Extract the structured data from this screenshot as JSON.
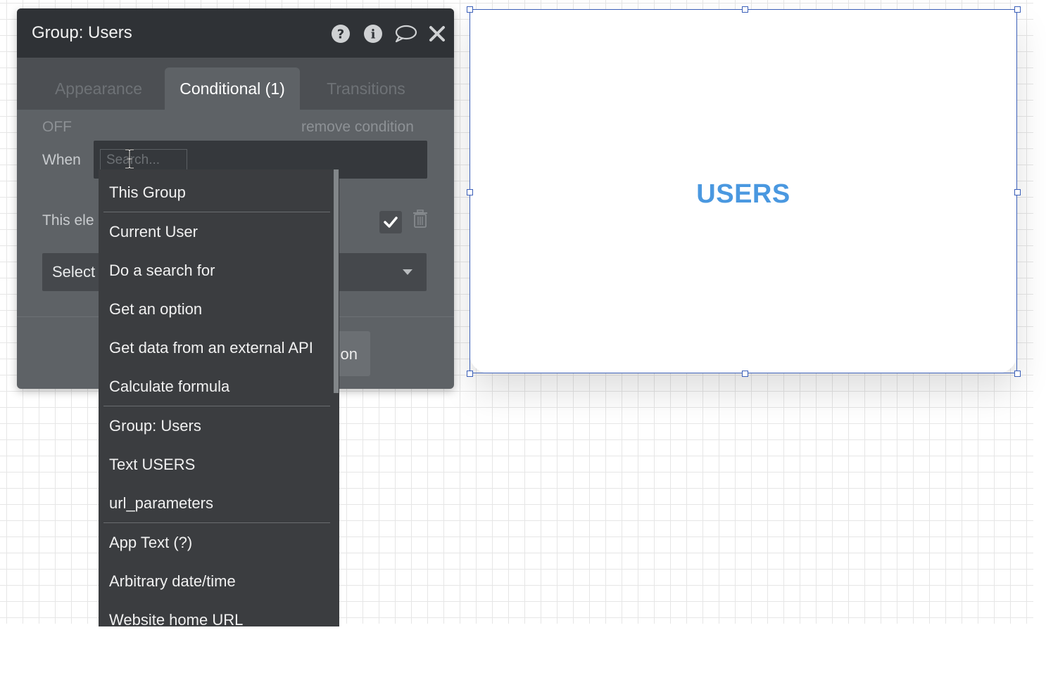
{
  "panel": {
    "title": "Group: Users",
    "tabs": [
      {
        "label": "Appearance",
        "active": false
      },
      {
        "label": "Conditional (1)",
        "active": true
      },
      {
        "label": "Transitions",
        "active": false
      }
    ],
    "status": "OFF",
    "remove_condition": "remove condition",
    "when_label": "When",
    "search_placeholder": "Search...",
    "this_element_label": "This ele",
    "select_label": "Select",
    "define_button_label": "on"
  },
  "dropdown": {
    "items": [
      "This Group",
      "Current User",
      "Do a search for",
      "Get an option",
      "Get data from an external API",
      "Calculate formula",
      "Group: Users",
      "Text USERS",
      "url_parameters",
      "App Text (?)",
      "Arbitrary date/time",
      "Website home URL"
    ]
  },
  "canvas": {
    "group_text": "USERS",
    "accent_color": "#4a98e0",
    "selection_color": "#3b5fb8"
  },
  "icons": [
    "help-icon",
    "info-icon",
    "comment-icon",
    "close-icon",
    "text-cursor-icon",
    "checkmark-icon",
    "trash-icon",
    "caret-down-icon"
  ]
}
